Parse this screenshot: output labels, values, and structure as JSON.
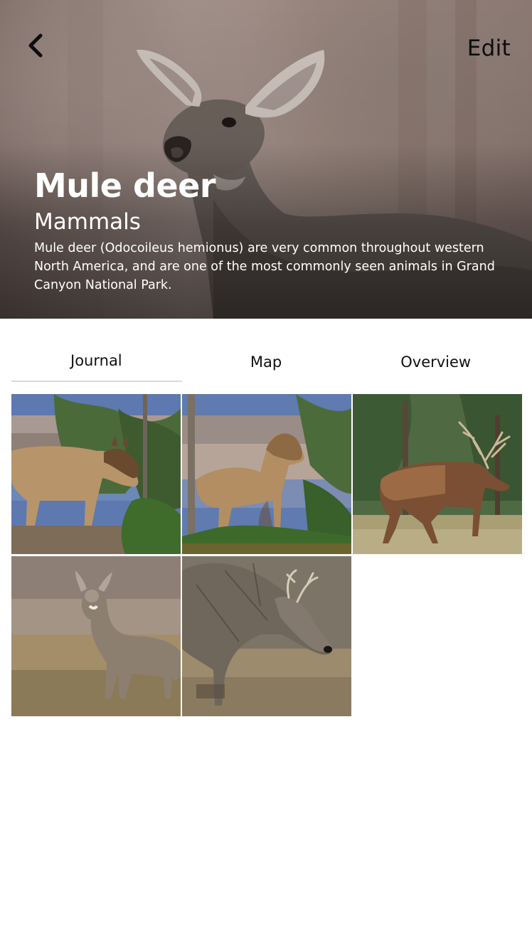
{
  "header": {
    "edit_label": "Edit",
    "back_icon": "chevron-left-icon"
  },
  "species": {
    "name": "Mule deer",
    "category": "Mammals",
    "description": "Mule deer (Odocoileus hemionus) are very common throughout western North America, and are one of the most commonly seen animals in Grand Canyon National Park."
  },
  "tabs": [
    {
      "label": "Journal",
      "active": true
    },
    {
      "label": "Map",
      "active": false
    },
    {
      "label": "Overview",
      "active": false
    }
  ],
  "journal_photos": [
    {
      "subject": "elk cow near juniper at canyon rim"
    },
    {
      "subject": "elk cow standing in front of canyon"
    },
    {
      "subject": "bull elk walking in forest"
    },
    {
      "subject": "mule deer doe in grassland"
    },
    {
      "subject": "mule deer buck grazing"
    }
  ],
  "colors": {
    "tab_underline": "#d9d9d9",
    "hero_text": "#ffffff",
    "edit_text": "#0d0d0d"
  }
}
